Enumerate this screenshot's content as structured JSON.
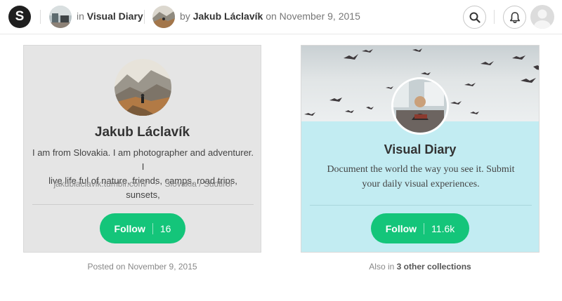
{
  "topbar": {
    "logo_letter": "S",
    "in_prefix": "in",
    "collection_name": "Visual Diary",
    "by_prefix": "by",
    "author_name": "Jakub Láclavík",
    "on_prefix": "on",
    "date": "November 9, 2015"
  },
  "author_card": {
    "name": "Jakub Láclavík",
    "bio_line1": "I am from Slovakia. I am photographer and adventurer. I",
    "bio_line2": "live life ful of nature, friends, camps, road trips, sunsets,",
    "link": "jakublaclavik.tumblr.com/",
    "separator": "·",
    "location": "Slovakia / Sudtirol",
    "follow_label": "Follow",
    "follow_count": "16"
  },
  "collection_card": {
    "name": "Visual Diary",
    "desc_line1": "Document the world the way you see it. Submit",
    "desc_line2": "your daily visual experiences.",
    "follow_label": "Follow",
    "follow_count": "11.6k"
  },
  "captions": {
    "posted_prefix": "Posted on",
    "posted_date": "November 9, 2015",
    "also_prefix": "Also in",
    "also_link": "3 other collections"
  },
  "colors": {
    "accent_green": "#14c57a",
    "collection_bg": "#c2ecf2",
    "author_bg": "#e5e5e5",
    "logo_bg": "#1f1f1f"
  }
}
